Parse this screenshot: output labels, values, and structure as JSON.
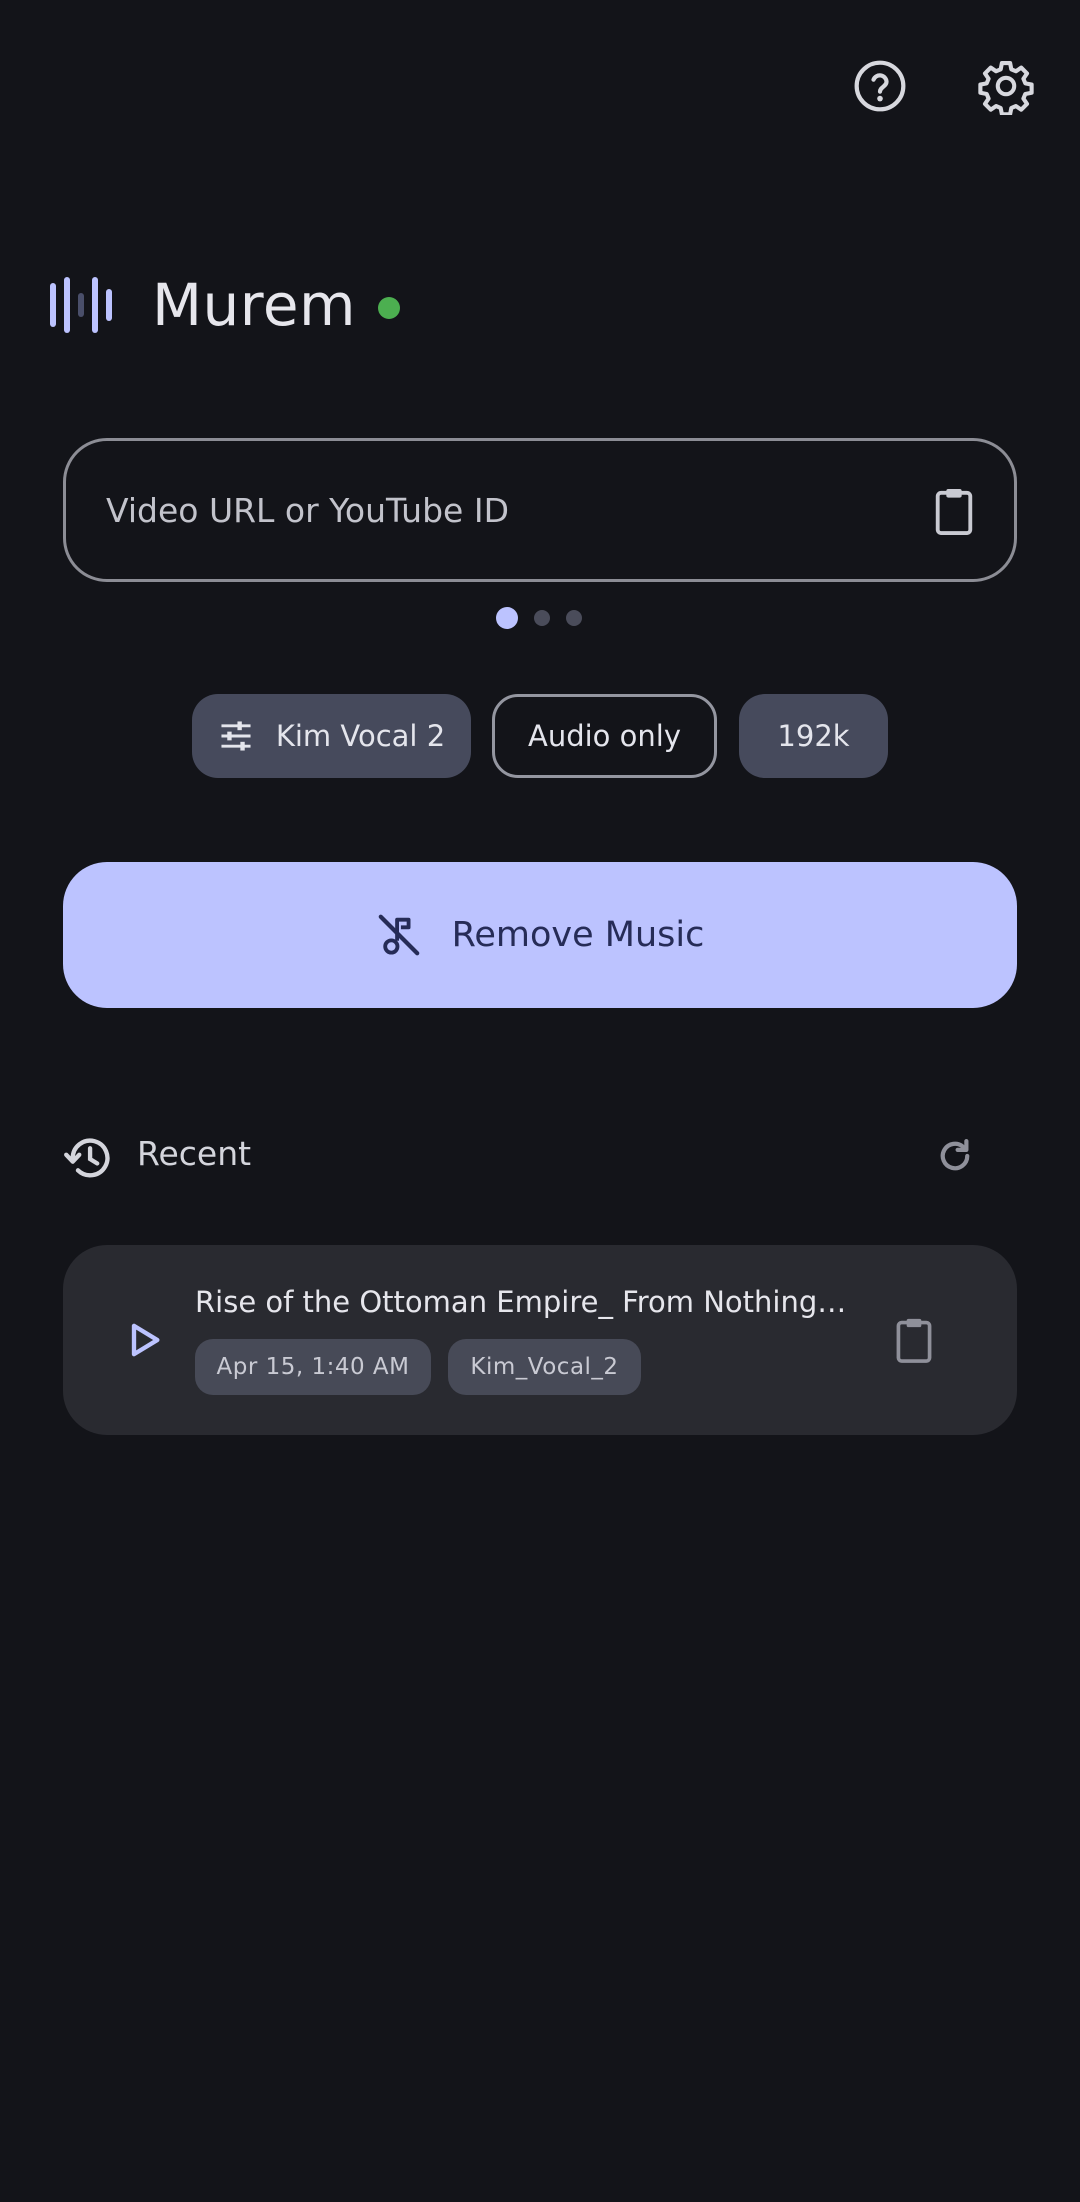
{
  "app": {
    "title": "Murem",
    "status_color": "#4caf50",
    "accent": "#bcc3ff"
  },
  "header": {
    "icons": [
      "help-icon",
      "settings-icon"
    ]
  },
  "url_input": {
    "placeholder": "Video URL or YouTube ID",
    "value": "",
    "action_icon": "clipboard-icon"
  },
  "pager": {
    "count": 3,
    "active": 1
  },
  "options": {
    "model_label": "Kim Vocal 2",
    "model_icon": "tune-icon",
    "mode_label": "Audio only",
    "bitrate_label": "192k"
  },
  "primary_action": {
    "label": "Remove Music",
    "icon": "music-off-icon"
  },
  "recent": {
    "title": "Recent",
    "icon": "history-icon",
    "refresh_icon": "refresh-icon",
    "items": [
      {
        "title": "Rise of the Ottoman Empire_ From Nothing to ...",
        "date": "Apr 15, 1:40 AM",
        "model": "Kim_Vocal_2",
        "play_icon": "play-icon",
        "copy_icon": "clipboard-icon"
      }
    ]
  }
}
